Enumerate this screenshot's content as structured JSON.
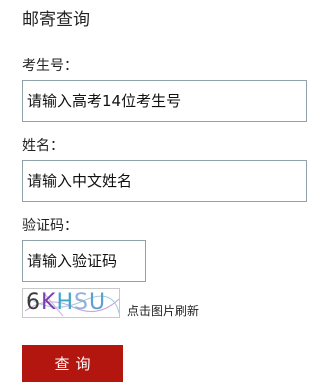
{
  "page": {
    "title": "邮寄查询"
  },
  "form": {
    "exam_number": {
      "label": "考生号：",
      "placeholder": "请输入高考14位考生号"
    },
    "name": {
      "label": "姓名：",
      "placeholder": "请输入中文姓名"
    },
    "captcha": {
      "label": "验证码：",
      "placeholder": "请输入验证码",
      "image_chars": [
        {
          "char": "6",
          "color": "#3a3a3a"
        },
        {
          "char": "K",
          "color": "#7b3fb0"
        },
        {
          "char": "H",
          "color": "#3aa7c9"
        },
        {
          "char": "S",
          "color": "#8fb0d8"
        },
        {
          "char": "U",
          "color": "#5aa0d0"
        }
      ],
      "refresh_text": "点击图片刷新"
    },
    "submit_label": "查询"
  },
  "colors": {
    "button_bg": "#b3150f",
    "input_border": "#8fa3ad"
  }
}
